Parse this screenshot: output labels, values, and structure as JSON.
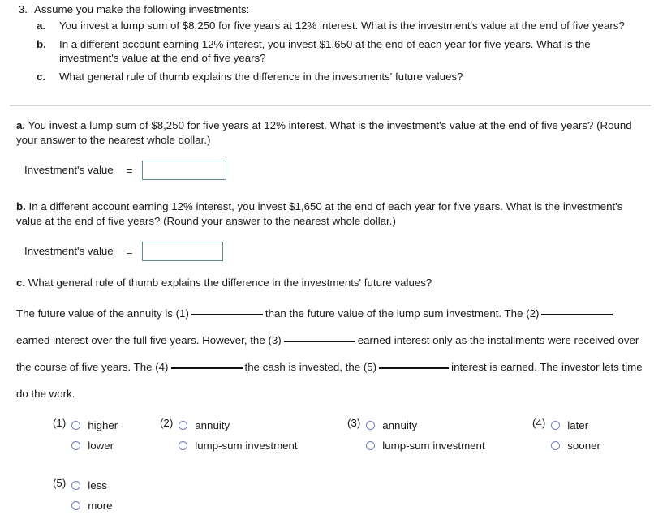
{
  "problem": {
    "number": "3.",
    "stem": "Assume you make the following investments:",
    "subparts": [
      {
        "marker": "a.",
        "text": "You invest a lump sum of $8,250 for five years at 12% interest. What is the investment's value at the end of five years?"
      },
      {
        "marker": "b.",
        "text": "In a different account earning 12% interest, you invest $1,650 at the end of each year for five years. What is the investment's value at the end of five years?"
      },
      {
        "marker": "c.",
        "text": "What general rule of thumb explains the difference in the investments' future values?"
      }
    ]
  },
  "answers": {
    "part_a": {
      "label": "a.",
      "question": "You invest a lump sum of $8,250 for five years at 12% interest. What is the investment's value at the end of five years? (Round your answer to the nearest whole dollar.)",
      "field_label": "Investment's value",
      "equals": "=",
      "value": "",
      "placeholder": ""
    },
    "part_b": {
      "label": "b.",
      "question": "In a different account earning 12% interest, you invest $1,650 at the end of each year for five years. What is the investment's value at the end of five years? (Round your answer to the nearest whole dollar.)",
      "field_label": "Investment's value",
      "equals": "=",
      "value": "",
      "placeholder": ""
    },
    "part_c": {
      "label": "c.",
      "question": "What general rule of thumb explains the difference in the investments' future values?"
    }
  },
  "fill_in": {
    "seg1": "The future value of the annuity is",
    "n1": "(1)",
    "seg2": "than the future value of the lump sum investment. The",
    "n2": "(2)",
    "seg3": "earned interest over the full five years. However, the",
    "n3": "(3)",
    "seg4": "earned interest only as the",
    "seg5": "installments were received over the course of five years. The",
    "n4": "(4)",
    "seg6": "the cash is invested, the",
    "n5": "(5)",
    "seg7": "interest is earned. The investor lets time do the work."
  },
  "radio_groups": [
    {
      "number": "(1)",
      "options": [
        "higher",
        "lower"
      ]
    },
    {
      "number": "(2)",
      "options": [
        "annuity",
        "lump-sum investment"
      ]
    },
    {
      "number": "(3)",
      "options": [
        "annuity",
        "lump-sum investment"
      ]
    },
    {
      "number": "(4)",
      "options": [
        "later",
        "sooner"
      ]
    },
    {
      "number": "(5)",
      "options": [
        "less",
        "more"
      ]
    }
  ],
  "colors": {
    "input_border": "#5a8f96",
    "radio_border": "#6f7fc0",
    "divider": "#d0d0d0",
    "text": "#1a1a1a"
  }
}
